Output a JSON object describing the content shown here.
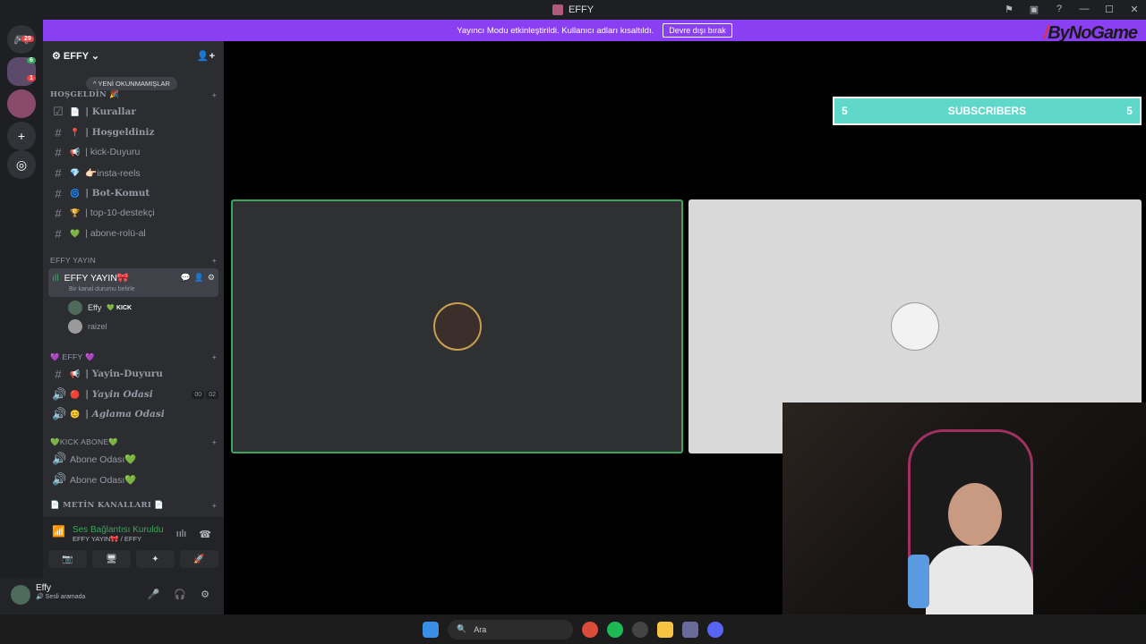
{
  "window": {
    "title": "EFFY"
  },
  "banner": {
    "text": "Yayıncı Modu etkinleştirildi. Kullanıcı adları kısaltıldı.",
    "button": "Devre dışı bırak"
  },
  "watermark": "ByNoGame",
  "guilds": {
    "dm_badge": "29",
    "server_badge_1": "6",
    "server_badge_2": "1"
  },
  "server": {
    "name": "EFFY",
    "new_unreads": "YENİ OKUNMAMIŞLAR"
  },
  "categories": {
    "hosgeldin": "HOŞGELDİN 🎉",
    "effy_yayin": "EFFY YAYIN",
    "effy": "💜 EFFY 💜",
    "kick_abone": "💚KICK ABONE💚",
    "metin": "📄 METİN KANALLARI 📄"
  },
  "channels_1": [
    {
      "emo": "📄",
      "label": "| Kurallar",
      "serif": true
    },
    {
      "emo": "📍",
      "label": "| Hoşgeldiniz",
      "serif": true
    },
    {
      "emo": "📢",
      "label": "| kick-Duyuru",
      "serif": false
    },
    {
      "emo": "💎",
      "label": "👉🏻insta-reels",
      "serif": false
    },
    {
      "emo": "🌀",
      "label": "| Bot-Komut",
      "serif": true
    },
    {
      "emo": "🏆",
      "label": "| top-10-destekçi",
      "serif": false
    },
    {
      "emo": "💚",
      "label": "| abone-rolü-al",
      "serif": false
    }
  ],
  "voice_channel": {
    "name": "EFFY YAYIN🎀",
    "status": "Bir kanal durumu belirle"
  },
  "voice_users": [
    {
      "name": "Effy",
      "tag": "💚 KICK"
    },
    {
      "name": "raizel",
      "tag": ""
    }
  ],
  "channels_2": [
    {
      "emo": "📢",
      "label": "| Yayin-Duyuru"
    },
    {
      "emo": "🔴",
      "label": "| Yayin Odasi",
      "c1": "00",
      "c2": "02"
    },
    {
      "emo": "😊",
      "label": "| Aglama Odasi"
    }
  ],
  "channels_3": [
    {
      "label": "Abone Odası💚"
    },
    {
      "label": "Abone Odası💚"
    }
  ],
  "connection": {
    "status": "Ses Bağlantısı Kuruldu",
    "location": "EFFY YAYIN🎀 / EFFY"
  },
  "user": {
    "name": "Effy",
    "status": "Sesli aramada"
  },
  "overlay": {
    "left_count": "5",
    "label": "SUBSCRIBERS",
    "right_count": "5"
  },
  "taskbar": {
    "search": "Ara"
  }
}
